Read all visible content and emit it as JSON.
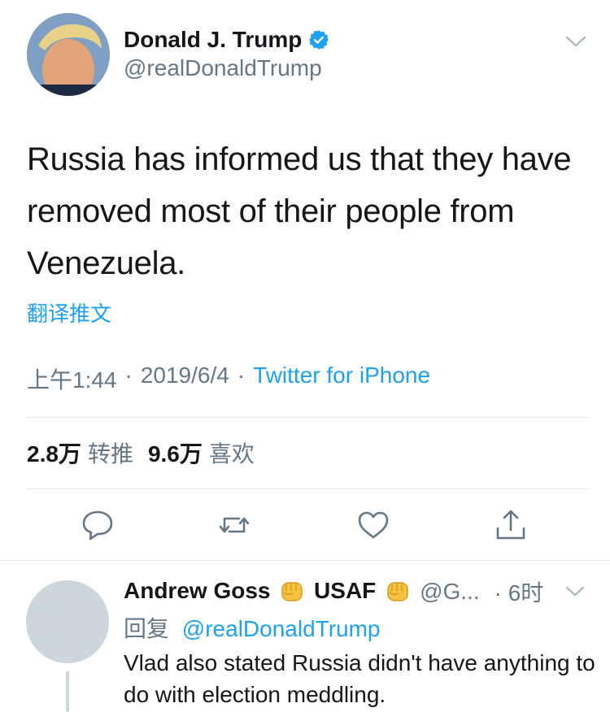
{
  "tweet": {
    "author_name": "Donald J. Trump",
    "author_handle": "@realDonaldTrump",
    "text": "Russia has informed us that they have removed most of their people from Venezuela.",
    "translate_label": "翻译推文",
    "time": "上午1:44",
    "date": "2019/6/4",
    "source": "Twitter for iPhone",
    "retweet_count": "2.8万",
    "retweet_label": "转推",
    "like_count": "9.6万",
    "like_label": "喜欢"
  },
  "actions": {
    "icons": [
      "reply-icon",
      "retweet-icon",
      "like-icon",
      "share-icon"
    ]
  },
  "reply": {
    "author_name_part1": "Andrew Goss",
    "author_name_part2": "USAF",
    "handle": "@G...",
    "time": "· 6时",
    "replying_to_label": "回复",
    "replying_to_handle": "@realDonaldTrump",
    "text": "Vlad also stated Russia didn't have anything to do with election meddling."
  },
  "colors": {
    "accent": "#1da1f2",
    "secondary_text": "#657786",
    "divider": "#e1e8ed"
  }
}
